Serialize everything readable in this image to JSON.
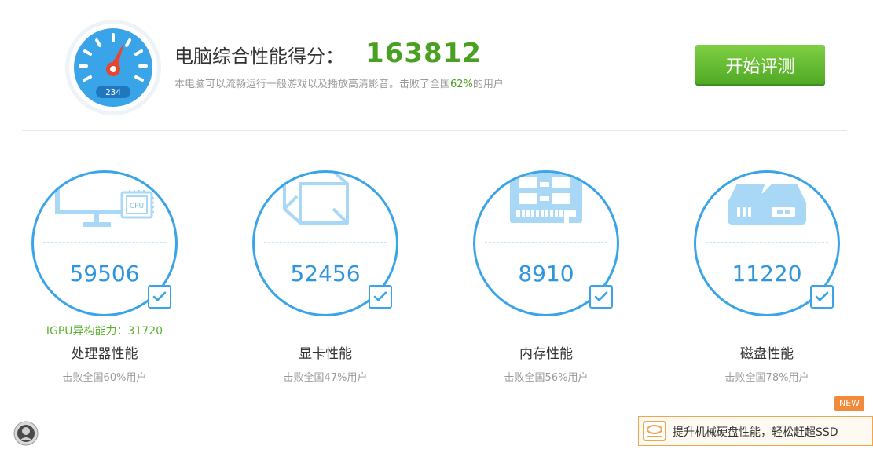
{
  "header": {
    "score_label": "电脑综合性能得分：",
    "score_value": "163812",
    "summary_prefix": "本电脑可以流畅运行一般游戏以及播放高清影音。击败了全国",
    "summary_percent": "62%",
    "summary_suffix": "的用户",
    "start_button": "开始评测",
    "gauge_digits": "234",
    "gauge_icon": "speedometer-icon"
  },
  "cards": [
    {
      "id": "cpu",
      "score": "59506",
      "title": "处理器性能",
      "beat": "击败全国60%用户",
      "extra": "IGPU异构能力：31720",
      "icon": "monitor-cpu-icon",
      "chip_label": "CPU"
    },
    {
      "id": "gpu",
      "score": "52456",
      "title": "显卡性能",
      "beat": "击败全国47%用户",
      "icon": "cube-icon"
    },
    {
      "id": "memory",
      "score": "8910",
      "title": "内存性能",
      "beat": "击败全国56%用户",
      "icon": "memory-module-icon"
    },
    {
      "id": "disk",
      "score": "11220",
      "title": "磁盘性能",
      "beat": "击败全国78%用户",
      "icon": "hard-disk-icon"
    }
  ],
  "footer": {
    "new_badge": "NEW",
    "promo_text": "提升机械硬盘性能，轻松赶超SSD",
    "promo_icon": "hdd-icon",
    "avatar_icon": "avatar-icon"
  },
  "colors": {
    "accent_blue": "#3aa4e8",
    "score_green": "#4aa022",
    "button_green": "#5cb82c",
    "badge_orange": "#f28a3c"
  }
}
